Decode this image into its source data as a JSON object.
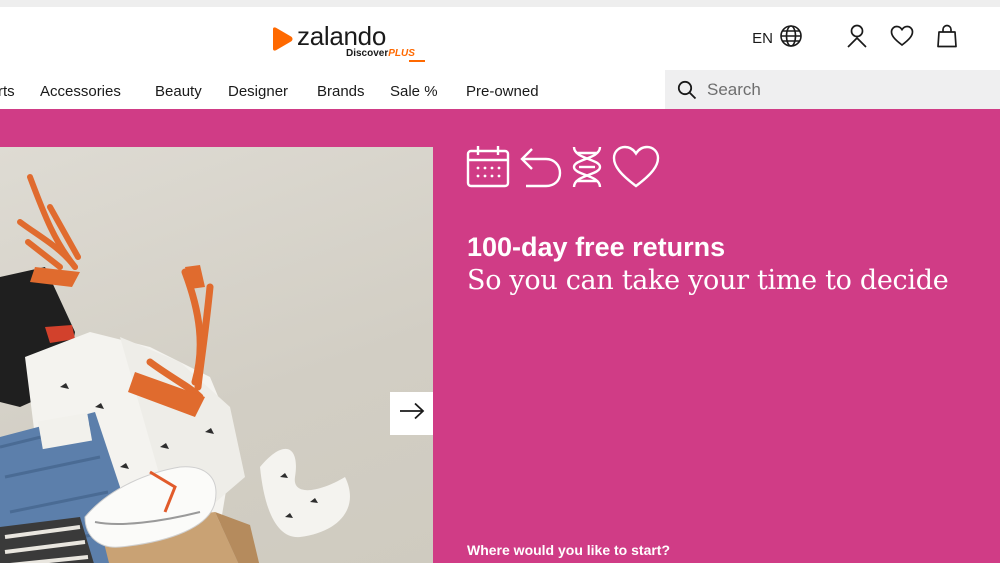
{
  "brand": {
    "name": "zalando",
    "subtitle": "Discover",
    "plus": "PLUS",
    "accent": "#ff6900"
  },
  "header": {
    "language": "EN",
    "icons": [
      "globe-icon",
      "account-icon",
      "wishlist-heart-icon",
      "shopping-bag-icon"
    ]
  },
  "nav": {
    "items": [
      {
        "label": "rts"
      },
      {
        "label": "Accessories"
      },
      {
        "label": "Beauty"
      },
      {
        "label": "Designer"
      },
      {
        "label": "Brands"
      },
      {
        "label": "Sale %"
      },
      {
        "label": "Pre-owned"
      }
    ]
  },
  "search": {
    "placeholder": "Search"
  },
  "hero": {
    "background": "#d03c86",
    "title": "100-day free returns",
    "subtitle": "So you can take your time to decide",
    "prompt": "Where would you like to start?",
    "benefit_icons": [
      "calendar-icon",
      "return-arrow-icon",
      "dna-icon",
      "heart-icon"
    ],
    "next_icon": "arrow-right-icon"
  }
}
